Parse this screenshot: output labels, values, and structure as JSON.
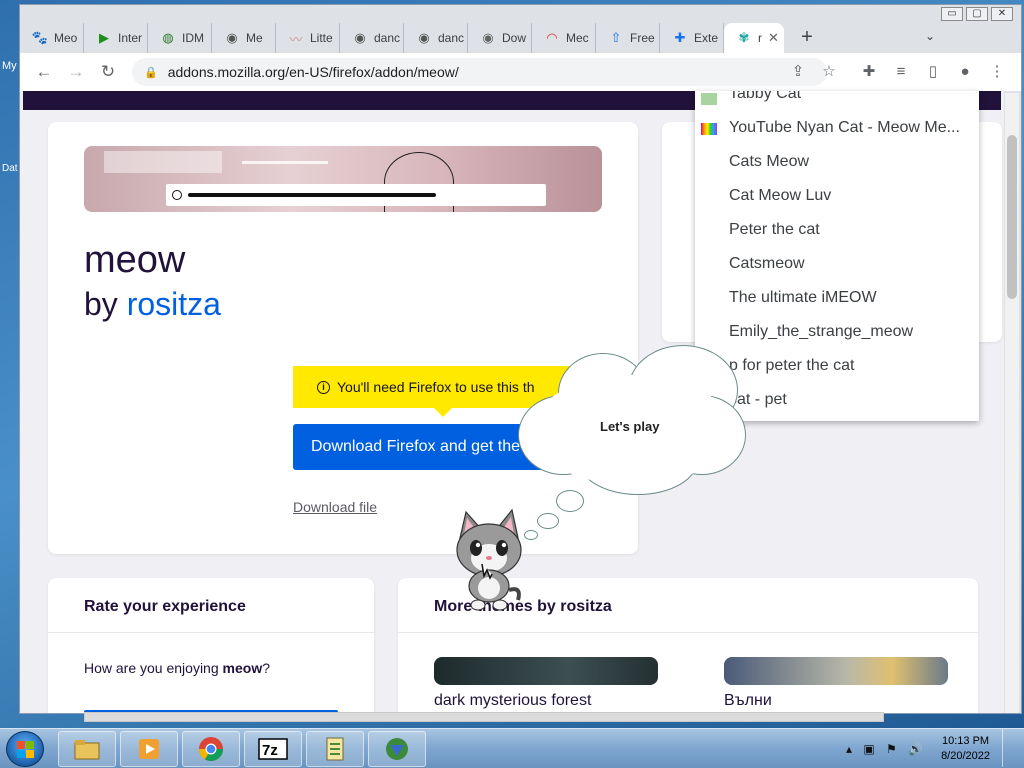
{
  "desktop": {
    "label_1": "My",
    "label_2": "Dat"
  },
  "window": {
    "minimize": "▭",
    "maximize": "▢",
    "close": "✕"
  },
  "tabs": [
    {
      "label": "Meo",
      "icon": "paw-icon"
    },
    {
      "label": "Inter",
      "icon": "play-icon"
    },
    {
      "label": "IDM",
      "icon": "idm-icon"
    },
    {
      "label": "Me",
      "icon": "globe-icon"
    },
    {
      "label": "Litte",
      "icon": "image-icon"
    },
    {
      "label": "danc",
      "icon": "globe-icon"
    },
    {
      "label": "danc",
      "icon": "globe-icon"
    },
    {
      "label": "Dow",
      "icon": "globe-icon"
    },
    {
      "label": "Mec",
      "icon": "rainbow-icon"
    },
    {
      "label": "Free",
      "icon": "upload-icon"
    },
    {
      "label": "Exte",
      "icon": "puzzle-icon"
    },
    {
      "label": "r",
      "icon": "addon-icon"
    }
  ],
  "toolbar": {
    "url": "addons.mozilla.org/en-US/firefox/addon/meow/"
  },
  "addon": {
    "title": "meow",
    "by": "by",
    "author": "rositza",
    "notice": "You'll need Firefox to use this th",
    "download_button": "Download Firefox and get the theme",
    "download_file": "Download file"
  },
  "rate": {
    "title": "Rate your experience",
    "question_pre": "How are you enjoying ",
    "question_name": "meow",
    "question_post": "?"
  },
  "more": {
    "title": "More themes by rositza",
    "themes": [
      {
        "name": "dark mysterious forest"
      },
      {
        "name": "Вълни"
      }
    ]
  },
  "dropdown": {
    "items": [
      "Tabby Cat",
      "YouTube Nyan Cat - Meow Me...",
      "Cats Meow",
      "Cat Meow Luv",
      "Peter the cat",
      "Catsmeow",
      "The ultimate iMEOW",
      "Emily_the_strange_meow",
      "p for peter the cat",
      "cat - pet"
    ]
  },
  "cloud": {
    "text": "Let's play"
  },
  "clock": {
    "time": "10:13 PM",
    "date": "8/20/2022"
  },
  "colors": {
    "accent": "#0060df",
    "notice": "#ffe900",
    "header": "#20123a"
  }
}
